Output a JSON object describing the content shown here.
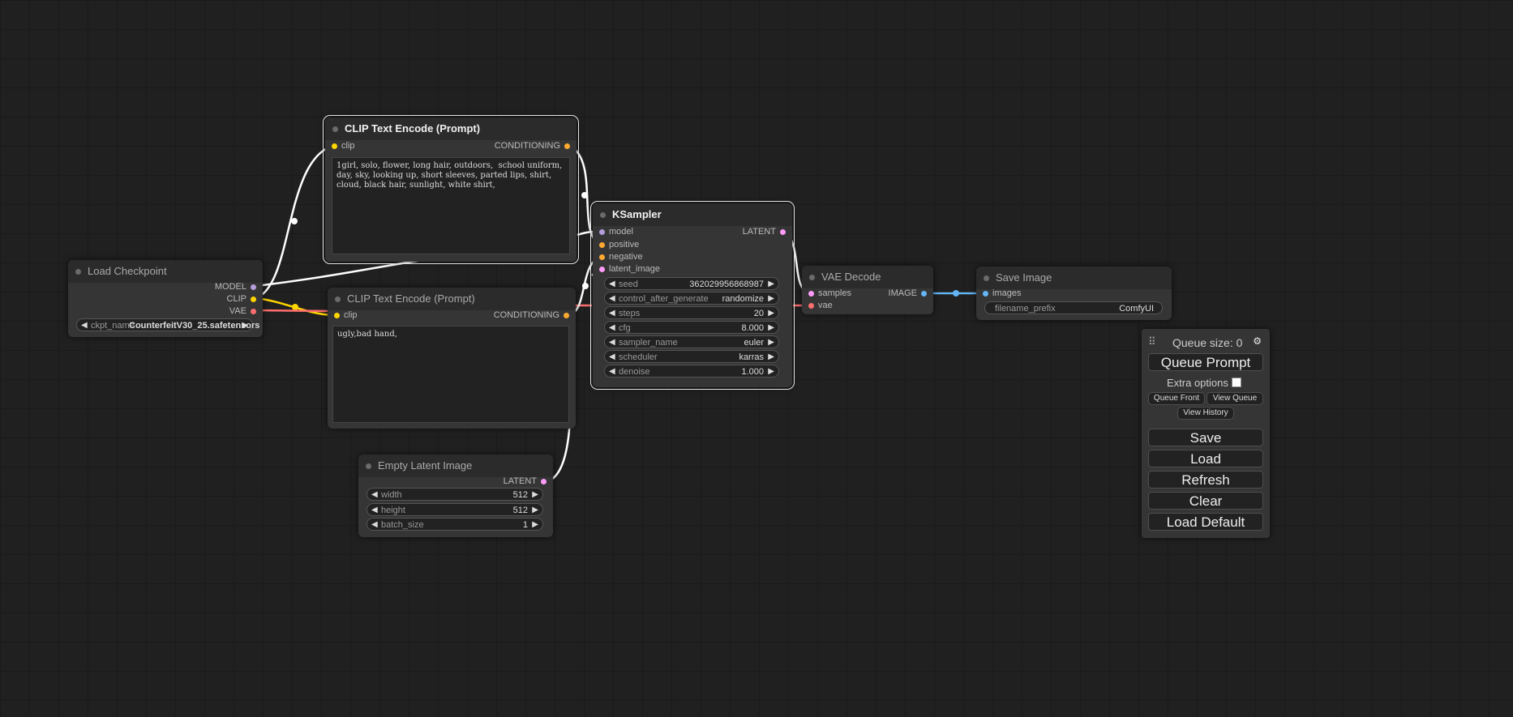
{
  "colors": {
    "clip": "#ffd500",
    "model": "#b39ddb",
    "vae": "#ff6e6e",
    "conditioning": "#ffa931",
    "latent": "#ff9cf9",
    "image": "#64b5f6"
  },
  "nodes": {
    "load_checkpoint": {
      "title": "Load Checkpoint",
      "outputs": [
        "MODEL",
        "CLIP",
        "VAE"
      ],
      "ckpt_name_label": "ckpt_name",
      "ckpt_name_value": "CounterfeitV30_25.safetensors"
    },
    "clip_pos": {
      "title": "CLIP Text Encode (Prompt)",
      "input": "clip",
      "output": "CONDITIONING",
      "text": "1girl, solo, flower, long hair, outdoors,  school uniform, day, sky, looking up, short sleeves, parted lips, shirt, cloud, black hair, sunlight, white shirt,"
    },
    "clip_neg": {
      "title": "CLIP Text Encode (Prompt)",
      "input": "clip",
      "output": "CONDITIONING",
      "text": "ugly,bad hand,"
    },
    "ksampler": {
      "title": "KSampler",
      "inputs": [
        "model",
        "positive",
        "negative",
        "latent_image"
      ],
      "output": "LATENT",
      "widgets": [
        {
          "name": "seed",
          "value": "362029956868987"
        },
        {
          "name": "control_after_generate",
          "value": "randomize"
        },
        {
          "name": "steps",
          "value": "20"
        },
        {
          "name": "cfg",
          "value": "8.000"
        },
        {
          "name": "sampler_name",
          "value": "euler"
        },
        {
          "name": "scheduler",
          "value": "karras"
        },
        {
          "name": "denoise",
          "value": "1.000"
        }
      ]
    },
    "empty_latent": {
      "title": "Empty Latent Image",
      "output": "LATENT",
      "widgets": [
        {
          "name": "width",
          "value": "512"
        },
        {
          "name": "height",
          "value": "512"
        },
        {
          "name": "batch_size",
          "value": "1"
        }
      ]
    },
    "vae_decode": {
      "title": "VAE Decode",
      "inputs": [
        "samples",
        "vae"
      ],
      "output": "IMAGE"
    },
    "save_image": {
      "title": "Save Image",
      "input": "images",
      "widget_name": "filename_prefix",
      "widget_value": "ComfyUI"
    }
  },
  "menu": {
    "handle": "⠿",
    "queue_size": "Queue size: 0",
    "queue_prompt": "Queue Prompt",
    "extra_options": "Extra options",
    "queue_front": "Queue Front",
    "view_queue": "View Queue",
    "view_history": "View History",
    "save": "Save",
    "load": "Load",
    "refresh": "Refresh",
    "clear": "Clear",
    "load_default": "Load Default"
  }
}
